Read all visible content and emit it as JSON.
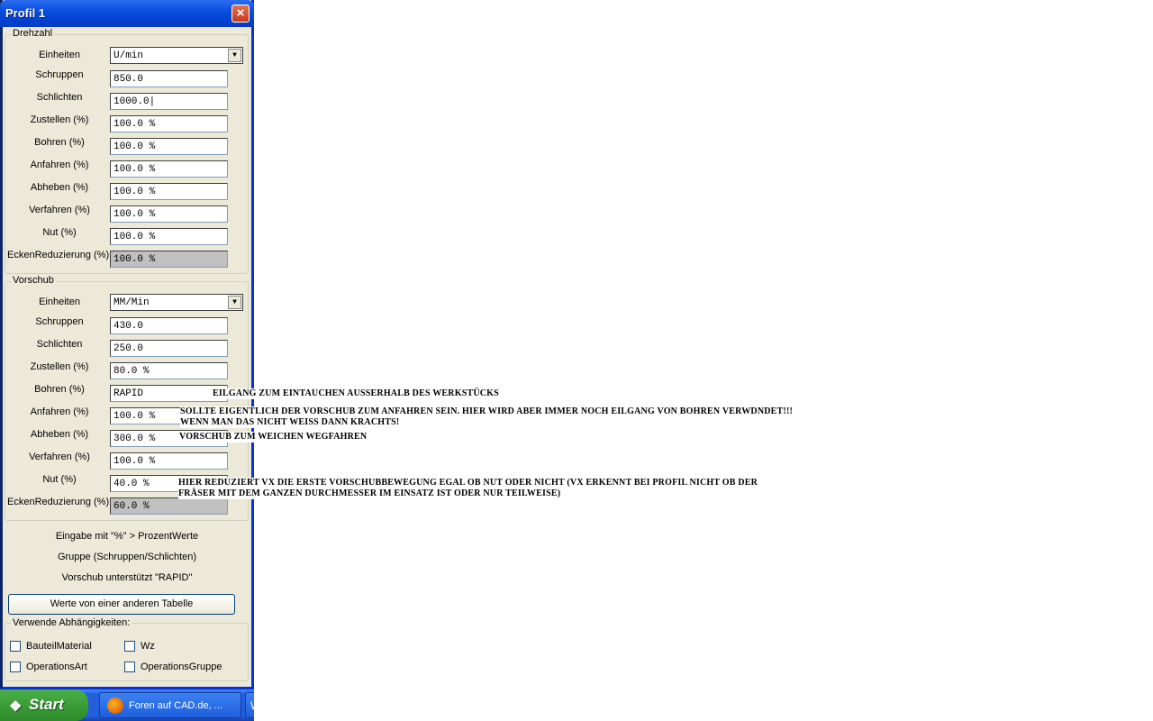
{
  "window": {
    "title": "Profil 1",
    "close_icon": "×"
  },
  "drehzahl": {
    "legend": "Drehzahl",
    "einheiten_label": "Einheiten",
    "einheiten_value": "U/min",
    "rows": [
      {
        "label": "Schruppen",
        "value": "850.0"
      },
      {
        "label": "Schlichten",
        "value": "1000.0|"
      },
      {
        "label": "Zustellen (%)",
        "value": "100.0 %"
      },
      {
        "label": "Bohren (%)",
        "value": "100.0 %"
      },
      {
        "label": "Anfahren (%)",
        "value": "100.0 %"
      },
      {
        "label": "Abheben (%)",
        "value": "100.0 %"
      },
      {
        "label": "Verfahren (%)",
        "value": "100.0 %"
      },
      {
        "label": "Nut (%)",
        "value": "100.0 %"
      },
      {
        "label": "EckenReduzierung (%)",
        "value": "100.0 %"
      }
    ]
  },
  "vorschub": {
    "legend": "Vorschub",
    "einheiten_label": "Einheiten",
    "einheiten_value": "MM/Min",
    "rows": [
      {
        "label": "Schruppen",
        "value": "430.0"
      },
      {
        "label": "Schlichten",
        "value": "250.0"
      },
      {
        "label": "Zustellen (%)",
        "value": "80.0 %"
      },
      {
        "label": "Bohren (%)",
        "value": "RAPID"
      },
      {
        "label": "Anfahren (%)",
        "value": "100.0 %"
      },
      {
        "label": "Abheben (%)",
        "value": "300.0 %"
      },
      {
        "label": "Verfahren (%)",
        "value": "100.0 %"
      },
      {
        "label": "Nut (%)",
        "value": "40.0 %"
      },
      {
        "label": "EckenReduzierung (%)",
        "value": "60.0 %"
      }
    ]
  },
  "info": {
    "line1": "Eingabe mit \"%\" > ProzentWerte",
    "line2": "Gruppe (Schruppen/Schlichten)",
    "line3": "Vorschub unterstützt \"RAPID\""
  },
  "button_other_table": "Werte von einer anderen Tabelle",
  "dependencies": {
    "legend": "Verwende Abhängigkeiten:",
    "bauteilmaterial": "BauteilMaterial",
    "wz": "Wz",
    "operationsart": "OperationsArt",
    "operationsgruppe": "OperationsGruppe"
  },
  "annotations": {
    "bohren": "Eilgang zum Eintauchen ausserhalb des Werkstücks",
    "anfahren_1": "Sollte eigentlich der Vorschub zum Anfahren sein. Hier wird aber immer noch Eilgang von Bohren verwdndet!!!",
    "anfahren_2": "Wenn man das nicht weiss dann krachts!",
    "abheben": "Vorschub zum weichen Wegfahren",
    "nut_1": "Hier reduziert VX die erste Vorschubbewegung egal ob Nut oder nicht (VX erkennt bei Profil nicht ob der",
    "nut_2": "Fräser mit dem ganzen Durchmesser im Einsatz ist oder nur teilweise)"
  },
  "taskbar": {
    "start_label": "Start",
    "task_label": "Foren auf CAD.de, ...",
    "task2_label": "W"
  }
}
